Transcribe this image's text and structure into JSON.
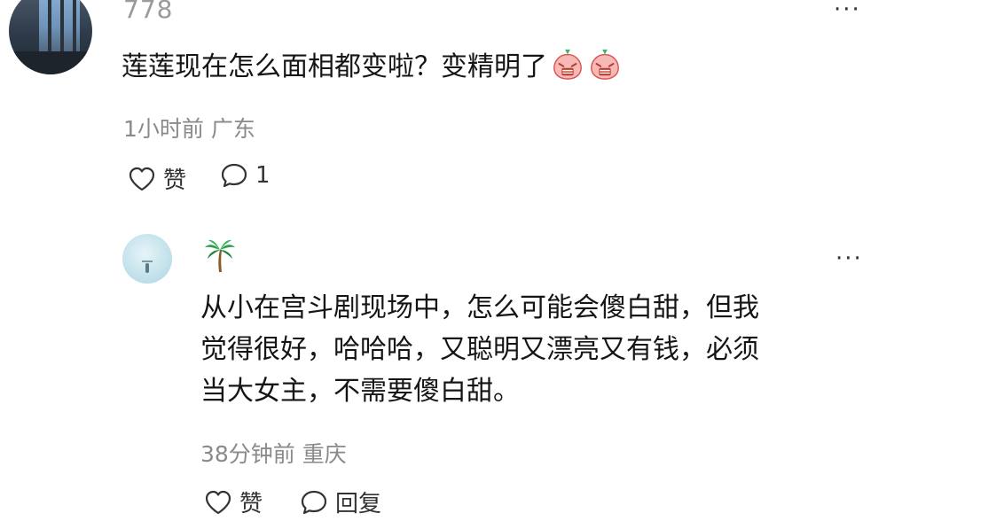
{
  "comment": {
    "username": "778",
    "text": "莲莲现在怎么面相都变啦？变精明了",
    "emojis": [
      "laughing-crying-face-icon",
      "laughing-crying-face-icon"
    ],
    "time": "1小时前",
    "location": "广东",
    "like_label": "赞",
    "reply_count": "1"
  },
  "reply": {
    "username_icon": "palm-tree-icon",
    "lines": [
      "从小在宫斗剧现场中，怎么可能会傻白甜，但我",
      "觉得很好，哈哈哈，又聪明又漂亮又有钱，必须",
      "当大女主，不需要傻白甜。"
    ],
    "time": "38分钟前",
    "location": "重庆",
    "like_label": "赞",
    "reply_label": "回复"
  },
  "more_label": "···"
}
